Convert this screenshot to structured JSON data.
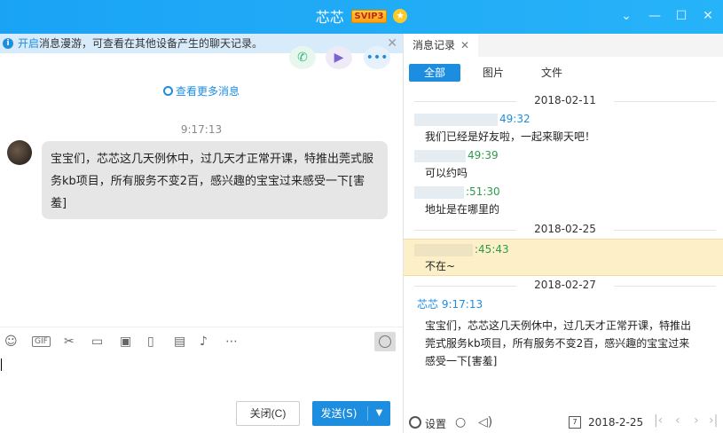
{
  "window": {
    "title": "芯芯",
    "badge": "SVIP3",
    "controls": {
      "dropdown": "⌄",
      "minimize": "—",
      "maximize": "☐",
      "close": "✕"
    }
  },
  "notice": {
    "highlight": "开启",
    "text": "消息漫游，可查看在其他设备产生的聊天记录。",
    "close": "✕"
  },
  "chat": {
    "more_messages": "查看更多消息",
    "timestamp": "9:17:13",
    "message": "宝宝们，芯芯这几天例休中，过几天才正常开课，特推出莞式服务kb项目，所有服务不变2百，感兴趣的宝宝过来感受一下[害羞]",
    "close_button": "关闭(C)",
    "send_button": "发送(S)"
  },
  "history": {
    "tab_label": "消息记录",
    "filters": [
      "全部",
      "图片",
      "文件"
    ],
    "dates": [
      "2018-02-11",
      "2018-02-25",
      "2018-02-27"
    ],
    "entries": [
      {
        "time": "49:32",
        "text": "我们已经是好友啦，一起来聊天吧！"
      },
      {
        "time": "49:39",
        "text": "可以约吗"
      },
      {
        "time": ":51:30",
        "text": "地址是在哪里的"
      },
      {
        "time": ":45:43",
        "text": "不在~"
      },
      {
        "sender": "芯芯",
        "time": "9:17:13",
        "text": "宝宝们，芯芯这几天例休中，过几天才正常开课，特推出莞式服务kb项目，所有服务不变2百，感兴趣的宝宝过来感受一下[害羞]"
      }
    ],
    "settings": "设置",
    "calendar_day": "7",
    "current_date": "2018-2-25"
  },
  "colors": {
    "accent": "#1d8de0",
    "titlebar": "#1aa3f5",
    "highlight_row": "#fdf0c9",
    "bubble": "#e6e6e6"
  }
}
